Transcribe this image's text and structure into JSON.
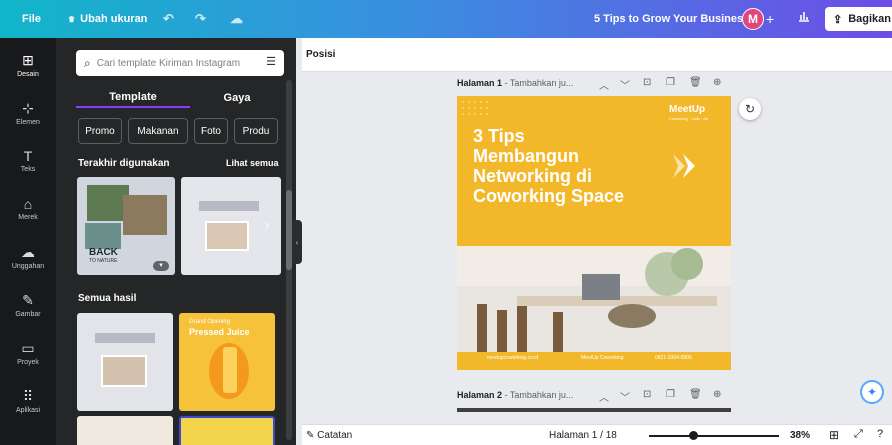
{
  "topbar": {
    "file": "File",
    "resize": "Ubah ukuran",
    "title": "5 Tips to Grow Your Business",
    "avatar_initial": "M",
    "share": "Bagikan"
  },
  "rail": {
    "items": [
      {
        "label": "Desain",
        "icon": "layout-icon",
        "glyph": "⊞"
      },
      {
        "label": "Elemen",
        "icon": "shapes-icon",
        "glyph": "⊹"
      },
      {
        "label": "Teks",
        "icon": "text-icon",
        "glyph": "T"
      },
      {
        "label": "Merek",
        "icon": "brand-icon",
        "glyph": "⌂"
      },
      {
        "label": "Unggahan",
        "icon": "upload-icon",
        "glyph": "☁"
      },
      {
        "label": "Gambar",
        "icon": "draw-icon",
        "glyph": "✎"
      },
      {
        "label": "Proyek",
        "icon": "folder-icon",
        "glyph": "▭"
      },
      {
        "label": "Aplikasi",
        "icon": "apps-icon",
        "glyph": "⠿"
      }
    ]
  },
  "panel": {
    "search_placeholder": "Cari template Kiriman Instagram",
    "tabs": [
      "Template",
      "Gaya"
    ],
    "chips": [
      "Promo",
      "Makanan",
      "Foto",
      "Produ"
    ],
    "recent_heading": "Terakhir digunakan",
    "see_all": "Lihat semua",
    "all_results_heading": "Semua hasil",
    "thumb_back_title": "BACK",
    "thumb_back_sub": "TO NATURE",
    "thumb_juice_top": "Grand Opening",
    "thumb_juice_title": "Pressed Juice"
  },
  "editor": {
    "position_label": "Posisi",
    "page1_label": "Halaman 1",
    "page1_sub": " - Tambahkan ju...",
    "page2_label": "Halaman 2",
    "page2_sub": " - Tambahkan ju...",
    "design": {
      "line1": "3 Tips",
      "line2": "Membangun",
      "line3": "Networking di",
      "line4": "Coworking Space",
      "brand": "MeetUp",
      "brand_sub": "Coworking · Cafe · Art",
      "footer1": "meetupcoworking.co.id",
      "footer2": "MeetUp Coworking",
      "footer3": "0821-3304-0906"
    }
  },
  "bottombar": {
    "notes": "Catatan",
    "page_indicator": "Halaman 1 / 18",
    "zoom": "38%",
    "zoom_fraction": 0.38
  },
  "colors": {
    "accent": "#8b3dff",
    "design_yellow": "#f3b72a"
  }
}
